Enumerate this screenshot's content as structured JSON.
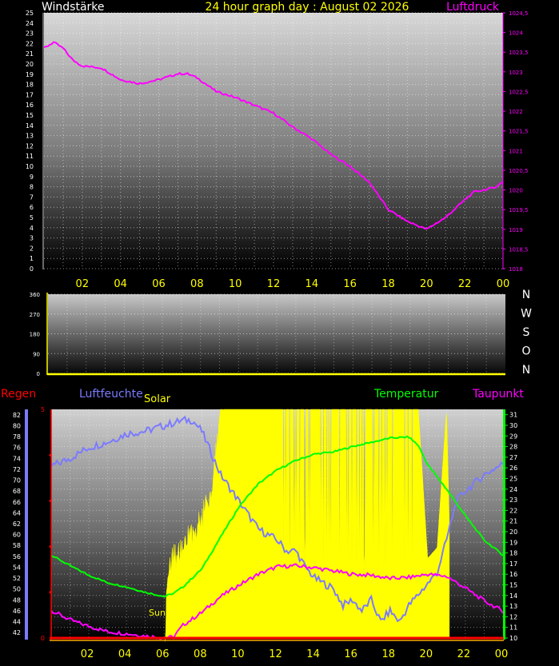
{
  "chart_data": [
    {
      "type": "line",
      "title": "24 hour graph day : August 02 2026",
      "left_axis_label": "Windstärke",
      "right_axis_label": "Luftdruck",
      "left_ticks": [
        "0",
        "1",
        "2",
        "3",
        "4",
        "5",
        "6",
        "7",
        "8",
        "9",
        "10",
        "11",
        "12",
        "13",
        "14",
        "15",
        "16",
        "17",
        "18",
        "19",
        "20",
        "21",
        "22",
        "23",
        "24",
        "25"
      ],
      "left_range": [
        0,
        25
      ],
      "right_ticks": [
        "1018",
        "1018,5",
        "1019",
        "1019,5",
        "1020",
        "1020,5",
        "1021",
        "1021,5",
        "1022",
        "1022,5",
        "1023",
        "1023,5",
        "1024",
        "1024,5"
      ],
      "right_range": [
        1018,
        1024.5
      ],
      "x_ticks": [
        "02",
        "04",
        "06",
        "08",
        "10",
        "12",
        "14",
        "16",
        "18",
        "20",
        "22",
        "00"
      ],
      "x_range": [
        0,
        24
      ],
      "grid": true,
      "series": [
        {
          "name": "Luftdruck",
          "axis": "right",
          "color": "#ff00ff",
          "x": [
            0,
            0.5,
            1,
            1.5,
            2,
            3,
            4,
            5,
            6,
            7,
            7.5,
            8,
            9,
            10,
            11,
            12,
            13,
            14,
            15,
            16,
            17,
            18,
            19,
            20,
            21,
            22,
            22.5,
            23,
            23.5,
            24
          ],
          "y": [
            1023.6,
            1023.75,
            1023.6,
            1023.3,
            1023.15,
            1023.1,
            1022.8,
            1022.7,
            1022.8,
            1022.95,
            1022.95,
            1022.85,
            1022.5,
            1022.35,
            1022.15,
            1021.95,
            1021.6,
            1021.3,
            1020.9,
            1020.6,
            1020.2,
            1019.5,
            1019.2,
            1019.0,
            1019.3,
            1019.75,
            1019.95,
            1020.0,
            1020.05,
            1020.2
          ]
        }
      ]
    },
    {
      "type": "scatter",
      "left_ticks": [
        "0",
        "90",
        "180",
        "270",
        "360"
      ],
      "left_range": [
        0,
        360
      ],
      "right_labels": [
        "N",
        "W",
        "S",
        "O",
        "N"
      ],
      "grid": true,
      "series": []
    },
    {
      "type": "line",
      "legend": [
        "Regen",
        "Luftfeuchte",
        "Solar",
        "Temperatur",
        "Taupunkt"
      ],
      "sun_label": "Sun",
      "humidity_ticks": [
        "42",
        "44",
        "46",
        "48",
        "50",
        "52",
        "54",
        "56",
        "58",
        "60",
        "62",
        "64",
        "66",
        "68",
        "70",
        "72",
        "74",
        "76",
        "78",
        "80",
        "82"
      ],
      "humidity_range": [
        41,
        83
      ],
      "rain_ticks": [
        "0",
        "5"
      ],
      "rain_range": [
        0,
        5
      ],
      "temp_ticks": [
        "10",
        "11",
        "12",
        "13",
        "14",
        "15",
        "16",
        "17",
        "18",
        "19",
        "20",
        "21",
        "22",
        "23",
        "24",
        "25",
        "26",
        "27",
        "28",
        "29",
        "30",
        "31"
      ],
      "temp_range": [
        10,
        31.5
      ],
      "x_ticks": [
        "02",
        "04",
        "06",
        "08",
        "10",
        "12",
        "14",
        "16",
        "18",
        "20",
        "22",
        "00"
      ],
      "x_range": [
        0,
        24
      ],
      "grid": true,
      "series": [
        {
          "name": "Luftfeuchte",
          "axis": "humidity",
          "color": "#7b7bff",
          "x": [
            0,
            1,
            2,
            3,
            4,
            5,
            6,
            6.5,
            7,
            7.5,
            8,
            8.5,
            9,
            10,
            11,
            12,
            12.5,
            13,
            13.5,
            14,
            14.5,
            15,
            15.5,
            16,
            16.5,
            17,
            17.5,
            18,
            18.5,
            19,
            19.5,
            20,
            20.5,
            21,
            21.5,
            22,
            23,
            24
          ],
          "y": [
            72.5,
            74,
            76,
            77,
            78.5,
            79,
            80,
            80.5,
            81,
            81,
            79,
            75,
            71,
            66,
            61,
            59,
            57,
            57,
            54,
            52,
            51,
            50,
            47,
            48,
            46,
            48,
            44,
            46,
            44,
            47,
            49,
            51,
            53,
            59,
            66,
            68,
            71,
            73
          ]
        },
        {
          "name": "Temperatur",
          "axis": "temp",
          "color": "#00ff00",
          "x": [
            0,
            1,
            2,
            3,
            4,
            5,
            6,
            6.5,
            7,
            8,
            9,
            10,
            11,
            12,
            13,
            14,
            15,
            16,
            17,
            18,
            19,
            19.5,
            20,
            21,
            22,
            23,
            24
          ],
          "y": [
            17.8,
            16.8,
            15.9,
            15.2,
            14.8,
            14.3,
            13.9,
            14.2,
            14.8,
            16.5,
            19.5,
            22.4,
            24.5,
            25.8,
            26.7,
            27.3,
            27.5,
            28.0,
            28.4,
            28.8,
            28.9,
            28.1,
            26.3,
            24.0,
            21.5,
            19.2,
            17.8
          ]
        },
        {
          "name": "Taupunkt",
          "axis": "temp",
          "color": "#ff00ff",
          "x": [
            0,
            1,
            2,
            3,
            4,
            5,
            6,
            6.5,
            7,
            8,
            9,
            10,
            11,
            12,
            13,
            14,
            15,
            16,
            17,
            18,
            19,
            20,
            21,
            22,
            23,
            24
          ],
          "y": [
            12.6,
            11.7,
            11.1,
            10.6,
            10.4,
            10.2,
            10.0,
            10.1,
            11.2,
            12.4,
            13.9,
            15.0,
            16.0,
            16.7,
            16.8,
            16.6,
            16.3,
            16.0,
            15.9,
            15.6,
            15.7,
            16.0,
            15.8,
            14.7,
            13.5,
            12.5
          ]
        },
        {
          "name": "Solar",
          "axis": "temp",
          "color": "#ffff00",
          "x": [
            0,
            6,
            6.3,
            7,
            7.5,
            8,
            8.5,
            9,
            9.5,
            10,
            11,
            12,
            13,
            14,
            15,
            16,
            17,
            18,
            19,
            19.5,
            20,
            20.5,
            21,
            21.3,
            24
          ],
          "y": [
            10,
            10,
            17,
            18.5,
            20,
            21,
            24,
            31.5,
            31.5,
            31.5,
            31.5,
            31.5,
            31.5,
            31.5,
            31.5,
            31.5,
            31.5,
            31.5,
            31.5,
            31.5,
            17.5,
            18.5,
            31.5,
            10,
            10
          ]
        },
        {
          "name": "Regen",
          "axis": "rain",
          "color": "#ff0000",
          "x": [
            0,
            24
          ],
          "y": [
            0,
            0
          ]
        }
      ]
    }
  ]
}
